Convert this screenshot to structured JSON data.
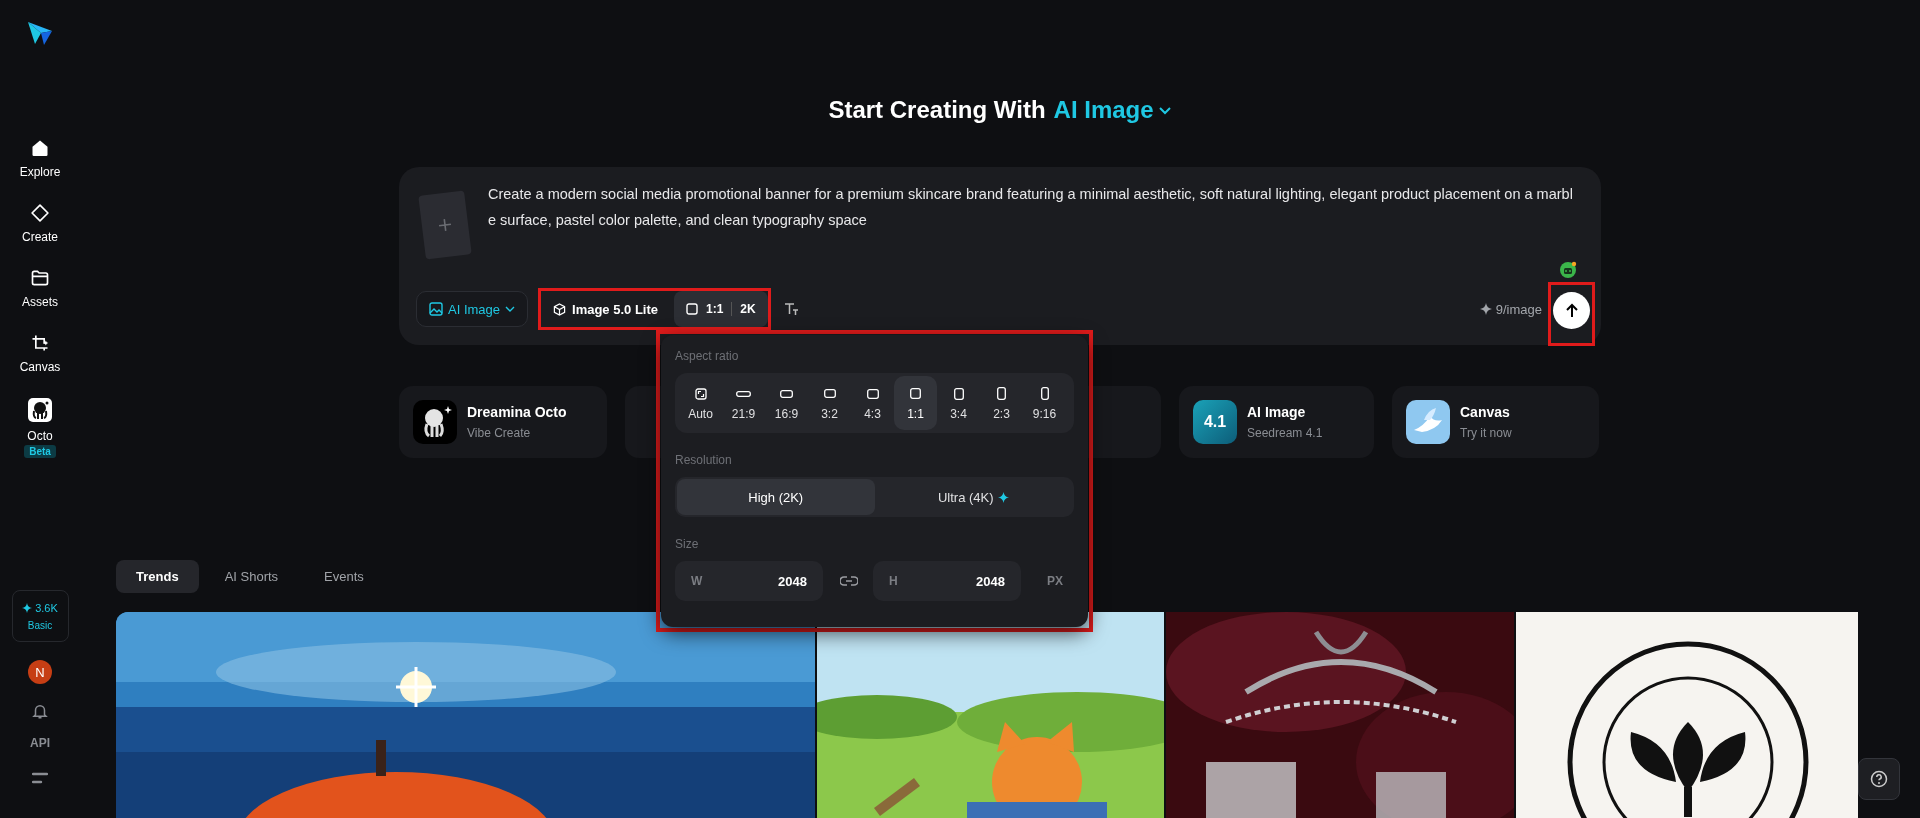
{
  "sidebar": {
    "items": [
      {
        "label": "Explore",
        "kind": "home"
      },
      {
        "label": "Create",
        "kind": "sparkle"
      },
      {
        "label": "Assets",
        "kind": "folder"
      },
      {
        "label": "Canvas",
        "kind": "frame"
      },
      {
        "label": "Octo",
        "kind": "octo",
        "badge": "Beta"
      }
    ],
    "credits": {
      "amount": "3.6K",
      "plan": "Basic"
    },
    "avatar": "N",
    "api": "API"
  },
  "heading": {
    "prefix": "Start Creating With",
    "mode": "AI Image"
  },
  "prompt": {
    "value": "Create a modern social media promotional banner for a premium skincare brand featuring a minimal aesthetic, soft natural lighting, elegant product placement on a marble surface, pastel color palette, and clean typography space",
    "mode_button": "AI Image",
    "model": "Image 5.0 Lite",
    "ratio": "1:1",
    "resolution": "2K",
    "settings_highlighted": true,
    "cost": "9/image",
    "send_highlighted": true
  },
  "popover": {
    "highlighted": true,
    "aspect_label": "Aspect ratio",
    "ratios": [
      {
        "label": "Auto",
        "kind": "auto",
        "selected": false
      },
      {
        "label": "21:9",
        "kind": "ultrawide",
        "selected": false
      },
      {
        "label": "16:9",
        "kind": "widescreen",
        "selected": false
      },
      {
        "label": "3:2",
        "kind": "landscape",
        "selected": false
      },
      {
        "label": "4:3",
        "kind": "standard",
        "selected": false
      },
      {
        "label": "1:1",
        "kind": "square",
        "selected": true
      },
      {
        "label": "3:4",
        "kind": "portrait",
        "selected": false
      },
      {
        "label": "2:3",
        "kind": "tall",
        "selected": false
      },
      {
        "label": "9:16",
        "kind": "vertical",
        "selected": false
      }
    ],
    "resolution_label": "Resolution",
    "resolutions": [
      {
        "label": "High (2K)",
        "selected": true,
        "premium": false
      },
      {
        "label": "Ultra (4K)",
        "selected": false,
        "premium": true
      }
    ],
    "size_label": "Size",
    "width": {
      "label": "W",
      "value": "2048"
    },
    "height": {
      "label": "H",
      "value": "2048"
    },
    "unit": "PX"
  },
  "cards": [
    {
      "kind": "octo",
      "title": "Dreamina Octo",
      "subtitle": "Vibe Create"
    },
    {
      "kind": "covered"
    },
    {
      "kind": "covered"
    },
    {
      "kind": "version",
      "icon_text": "4.1",
      "title": "AI Image",
      "subtitle": "Seedream 4.1"
    },
    {
      "kind": "canvas",
      "title": "Canvas",
      "subtitle": "Try it now"
    }
  ],
  "tabs": [
    {
      "label": "Trends",
      "selected": true
    },
    {
      "label": "AI Shorts",
      "selected": false
    },
    {
      "label": "Events",
      "selected": false
    }
  ]
}
